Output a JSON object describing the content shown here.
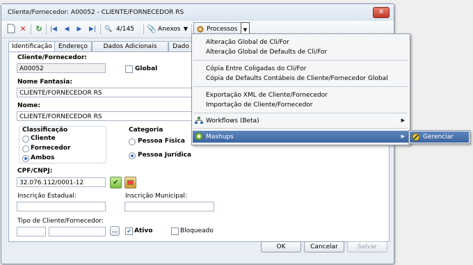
{
  "window": {
    "title": "Cliente/Fornecedor: A00052 - CLIENTE/FORNECEDOR RS",
    "close": "✕"
  },
  "toolbar": {
    "record_count": "4/145",
    "attachments_label": "Anexos",
    "processes_label": "Processos"
  },
  "tabs": [
    "Identificação",
    "Endereço",
    "Dados Adicionais",
    "Dado"
  ],
  "form": {
    "code_label": "Cliente/Fornecedor:",
    "code_value": "A00052",
    "global_label": "Global",
    "fantasy_label": "Nome Fantasia:",
    "fantasy_value": "CLIENTE/FORNECEDOR RS",
    "name_label": "Nome:",
    "name_value": "CLIENTE/FORNECEDOR RS",
    "classification_label": "Classificação",
    "classification_options": [
      "Cliente",
      "Fornecedor",
      "Ambos"
    ],
    "classification_selected": "Ambos",
    "category_label": "Categoria",
    "category_options": [
      "Pessoa Física",
      "Pessoa Jurídica"
    ],
    "category_selected": "Pessoa Jurídica",
    "cpf_label": "CPF/CNPJ:",
    "cpf_value": "32.076.112/0001-12",
    "state_reg_label": "Inscrição Estadual:",
    "city_reg_label": "Inscrição Municipal:",
    "type_label": "Tipo de Cliente/Fornecedor:",
    "ellipsis": "...",
    "active_label": "Ativo",
    "active_checked": true,
    "blocked_label": "Bloqueado",
    "blocked_checked": false
  },
  "buttons": {
    "ok": "OK",
    "cancel": "Cancelar",
    "save": "Salvar"
  },
  "menu": {
    "items": [
      "Alteração Global de Cli/For",
      "Alteração Global de Defaults de Cli/For",
      "Cópia Entre Coligadas do Cli/For",
      "Cópia de Defaults Contábeis de Cliente/Fornecedor Global",
      "Exportação XML de Cliente/Fornecedor",
      "Importação de Cliente/Fornecedor",
      "Workflows (Beta)",
      "Mashups"
    ],
    "highlighted": "Mashups",
    "submenu": [
      "Gerenciar"
    ]
  },
  "colors": {
    "accent": "#3c64a0",
    "highlight": "#5e86bd",
    "window_bg": "#e9eef5"
  }
}
